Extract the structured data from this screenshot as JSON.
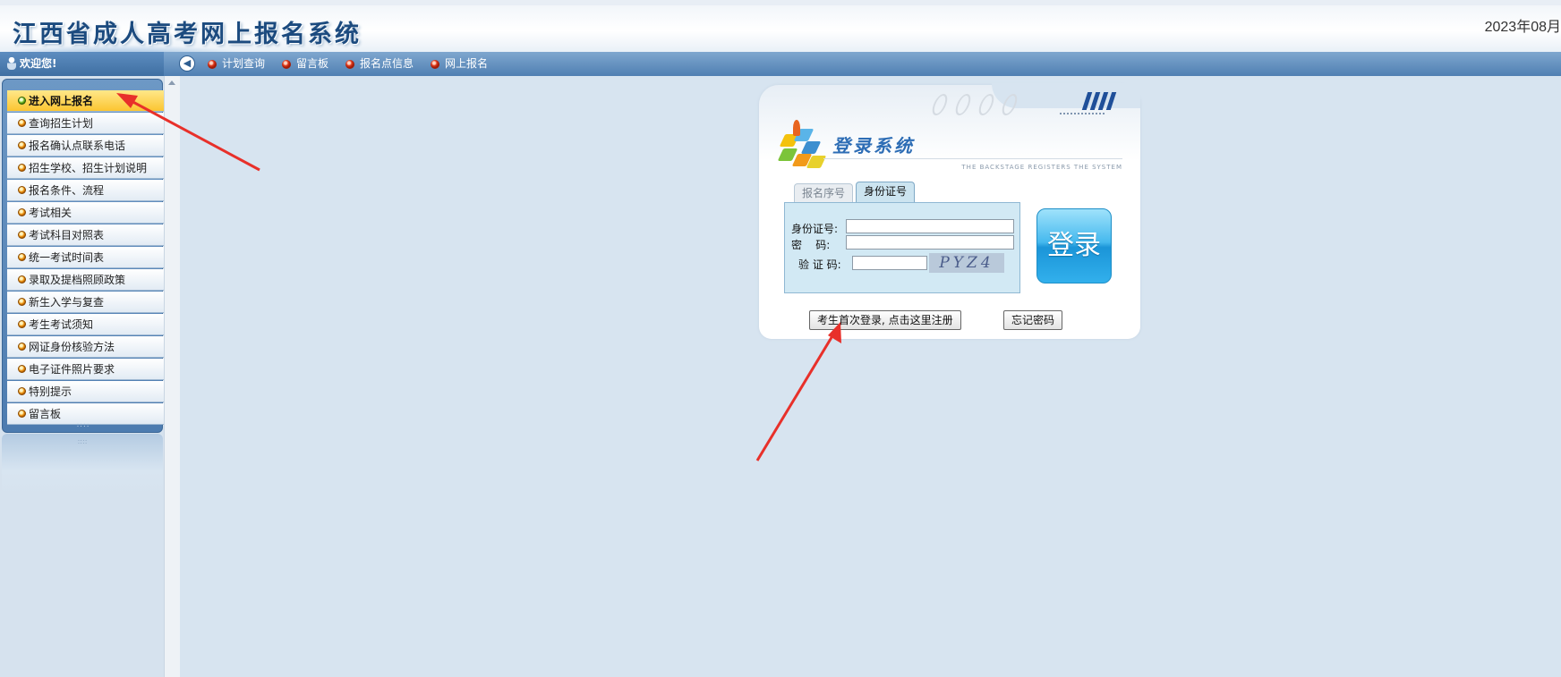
{
  "header": {
    "title": "江西省成人高考网上报名系统",
    "date": "2023年08月"
  },
  "navbar": {
    "welcome": "欢迎您!",
    "collapse_icon": "◀",
    "links": [
      "计划查询",
      "留言板",
      "报名点信息",
      "网上报名"
    ]
  },
  "sidebar": {
    "items": [
      "进入网上报名",
      "查询招生计划",
      "报名确认点联系电话",
      "招生学校、招生计划说明",
      "报名条件、流程",
      "考试相关",
      "考试科目对照表",
      "统一考试时间表",
      "录取及提档照顾政策",
      "新生入学与复查",
      "考生考试须知",
      "网证身份核验方法",
      "电子证件照片要求",
      "特别提示",
      "留言板"
    ],
    "active_index": 0,
    "grip": "::::"
  },
  "login": {
    "title": "登录系统",
    "subtitle": "THE BACKSTAGE REGISTERS THE SYSTEM",
    "tabs": [
      "报名序号",
      "身份证号"
    ],
    "active_tab": "身份证号",
    "fields": {
      "id_label": "身份证号:",
      "password_label": "密    码:",
      "captcha_label": "验 证 码:",
      "id_value": "",
      "password_value": "",
      "captcha_value": ""
    },
    "captcha_text": "PYZ4",
    "login_button": "登录",
    "register_button": "考生首次登录, 点击这里注册",
    "forgot_button": "忘记密码"
  },
  "colors": {
    "page_bg": "#d7e4f0",
    "nav_bar": "#4f7fb2",
    "active_menu": "#fbc531",
    "login_button": "#1b95d8",
    "annotation_arrow": "#e8302a"
  }
}
